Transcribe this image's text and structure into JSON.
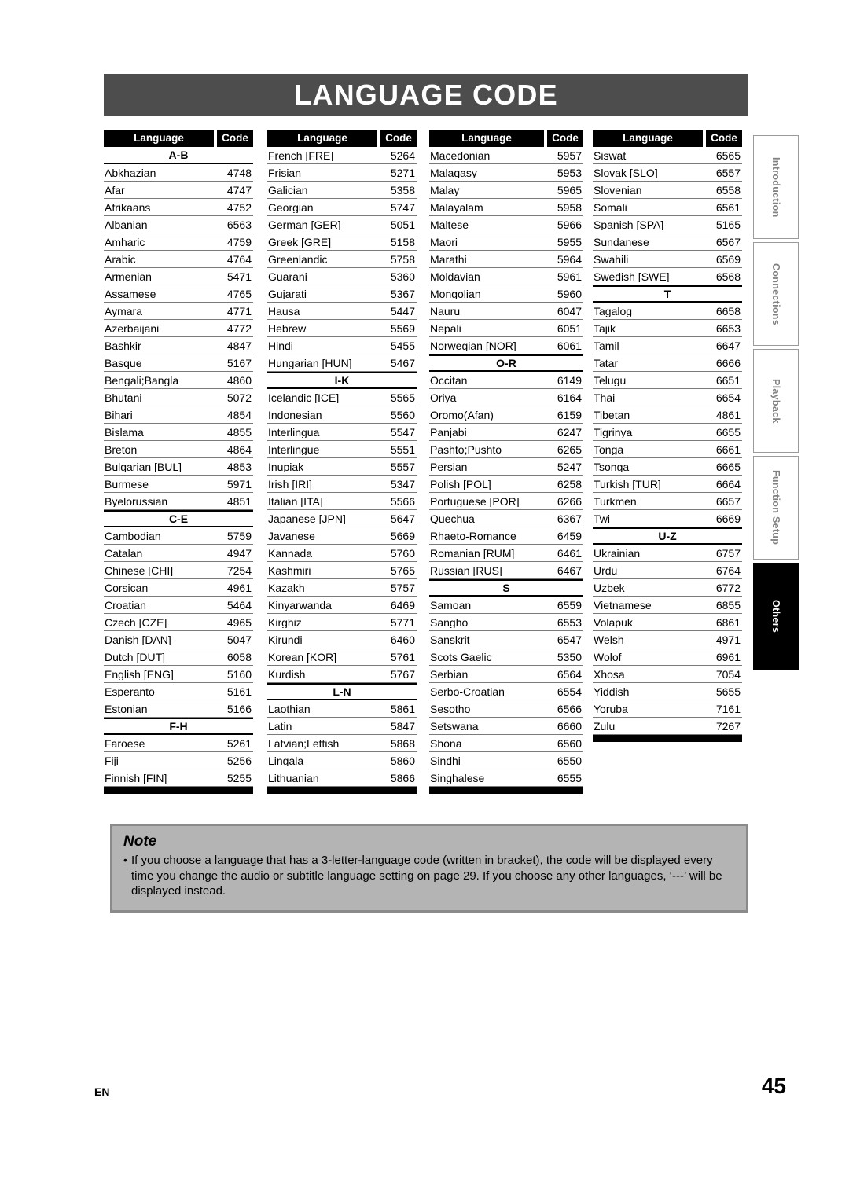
{
  "page": {
    "title": "LANGUAGE CODE",
    "footer_language": "EN",
    "footer_page_number": "45"
  },
  "side_tabs": [
    {
      "label": "Introduction",
      "active": false
    },
    {
      "label": "Connections",
      "active": false
    },
    {
      "label": "Playback",
      "active": false
    },
    {
      "label": "Function Setup",
      "active": false
    },
    {
      "label": "Others",
      "active": true
    }
  ],
  "table_headers": {
    "language": "Language",
    "code": "Code"
  },
  "tables": [
    {
      "rows": [
        {
          "type": "group",
          "label": "A-B"
        },
        {
          "type": "entry",
          "language": "Abkhazian",
          "code": "4748"
        },
        {
          "type": "entry",
          "language": "Afar",
          "code": "4747"
        },
        {
          "type": "entry",
          "language": "Afrikaans",
          "code": "4752"
        },
        {
          "type": "entry",
          "language": "Albanian",
          "code": "6563"
        },
        {
          "type": "entry",
          "language": "Amharic",
          "code": "4759"
        },
        {
          "type": "entry",
          "language": "Arabic",
          "code": "4764"
        },
        {
          "type": "entry",
          "language": "Armenian",
          "code": "5471"
        },
        {
          "type": "entry",
          "language": "Assamese",
          "code": "4765"
        },
        {
          "type": "entry",
          "language": "Aymara",
          "code": "4771"
        },
        {
          "type": "entry",
          "language": "Azerbaijani",
          "code": "4772"
        },
        {
          "type": "entry",
          "language": "Bashkir",
          "code": "4847"
        },
        {
          "type": "entry",
          "language": "Basque",
          "code": "5167"
        },
        {
          "type": "entry",
          "language": "Bengali;Bangla",
          "code": "4860"
        },
        {
          "type": "entry",
          "language": "Bhutani",
          "code": "5072"
        },
        {
          "type": "entry",
          "language": "Bihari",
          "code": "4854"
        },
        {
          "type": "entry",
          "language": "Bislama",
          "code": "4855"
        },
        {
          "type": "entry",
          "language": "Breton",
          "code": "4864"
        },
        {
          "type": "entry",
          "language": "Bulgarian [BUL]",
          "code": "4853"
        },
        {
          "type": "entry",
          "language": "Burmese",
          "code": "5971"
        },
        {
          "type": "entry",
          "language": "Byelorussian",
          "code": "4851"
        },
        {
          "type": "group",
          "label": "C-E"
        },
        {
          "type": "entry",
          "language": "Cambodian",
          "code": "5759"
        },
        {
          "type": "entry",
          "language": "Catalan",
          "code": "4947"
        },
        {
          "type": "entry",
          "language": "Chinese [CHI]",
          "code": "7254"
        },
        {
          "type": "entry",
          "language": "Corsican",
          "code": "4961"
        },
        {
          "type": "entry",
          "language": "Croatian",
          "code": "5464"
        },
        {
          "type": "entry",
          "language": "Czech [CZE]",
          "code": "4965"
        },
        {
          "type": "entry",
          "language": "Danish [DAN]",
          "code": "5047"
        },
        {
          "type": "entry",
          "language": "Dutch [DUT]",
          "code": "6058"
        },
        {
          "type": "entry",
          "language": "English [ENG]",
          "code": "5160"
        },
        {
          "type": "entry",
          "language": "Esperanto",
          "code": "5161"
        },
        {
          "type": "entry",
          "language": "Estonian",
          "code": "5166"
        },
        {
          "type": "group",
          "label": "F-H"
        },
        {
          "type": "entry",
          "language": "Faroese",
          "code": "5261"
        },
        {
          "type": "entry",
          "language": "Fiji",
          "code": "5256"
        },
        {
          "type": "entry",
          "language": "Finnish [FIN]",
          "code": "5255"
        }
      ]
    },
    {
      "rows": [
        {
          "type": "entry",
          "language": "French [FRE]",
          "code": "5264"
        },
        {
          "type": "entry",
          "language": "Frisian",
          "code": "5271"
        },
        {
          "type": "entry",
          "language": "Galician",
          "code": "5358"
        },
        {
          "type": "entry",
          "language": "Georgian",
          "code": "5747"
        },
        {
          "type": "entry",
          "language": "German [GER]",
          "code": "5051"
        },
        {
          "type": "entry",
          "language": "Greek [GRE]",
          "code": "5158"
        },
        {
          "type": "entry",
          "language": "Greenlandic",
          "code": "5758"
        },
        {
          "type": "entry",
          "language": "Guarani",
          "code": "5360"
        },
        {
          "type": "entry",
          "language": "Gujarati",
          "code": "5367"
        },
        {
          "type": "entry",
          "language": "Hausa",
          "code": "5447"
        },
        {
          "type": "entry",
          "language": "Hebrew",
          "code": "5569"
        },
        {
          "type": "entry",
          "language": "Hindi",
          "code": "5455"
        },
        {
          "type": "entry",
          "language": "Hungarian [HUN]",
          "code": "5467"
        },
        {
          "type": "group",
          "label": "I-K"
        },
        {
          "type": "entry",
          "language": "Icelandic [ICE]",
          "code": "5565"
        },
        {
          "type": "entry",
          "language": "Indonesian",
          "code": "5560"
        },
        {
          "type": "entry",
          "language": "Interlingua",
          "code": "5547"
        },
        {
          "type": "entry",
          "language": "Interlingue",
          "code": "5551"
        },
        {
          "type": "entry",
          "language": "Inupiak",
          "code": "5557"
        },
        {
          "type": "entry",
          "language": "Irish [IRI]",
          "code": "5347"
        },
        {
          "type": "entry",
          "language": "Italian [ITA]",
          "code": "5566"
        },
        {
          "type": "entry",
          "language": "Japanese [JPN]",
          "code": "5647"
        },
        {
          "type": "entry",
          "language": "Javanese",
          "code": "5669"
        },
        {
          "type": "entry",
          "language": "Kannada",
          "code": "5760"
        },
        {
          "type": "entry",
          "language": "Kashmiri",
          "code": "5765"
        },
        {
          "type": "entry",
          "language": "Kazakh",
          "code": "5757"
        },
        {
          "type": "entry",
          "language": "Kinyarwanda",
          "code": "6469"
        },
        {
          "type": "entry",
          "language": "Kirghiz",
          "code": "5771"
        },
        {
          "type": "entry",
          "language": "Kirundi",
          "code": "6460"
        },
        {
          "type": "entry",
          "language": "Korean [KOR]",
          "code": "5761"
        },
        {
          "type": "entry",
          "language": "Kurdish",
          "code": "5767"
        },
        {
          "type": "group",
          "label": "L-N"
        },
        {
          "type": "entry",
          "language": "Laothian",
          "code": "5861"
        },
        {
          "type": "entry",
          "language": "Latin",
          "code": "5847"
        },
        {
          "type": "entry",
          "language": "Latvian;Lettish",
          "code": "5868"
        },
        {
          "type": "entry",
          "language": "Lingala",
          "code": "5860"
        },
        {
          "type": "entry",
          "language": "Lithuanian",
          "code": "5866"
        }
      ]
    },
    {
      "rows": [
        {
          "type": "entry",
          "language": "Macedonian",
          "code": "5957"
        },
        {
          "type": "entry",
          "language": "Malagasy",
          "code": "5953"
        },
        {
          "type": "entry",
          "language": "Malay",
          "code": "5965"
        },
        {
          "type": "entry",
          "language": "Malayalam",
          "code": "5958"
        },
        {
          "type": "entry",
          "language": "Maltese",
          "code": "5966"
        },
        {
          "type": "entry",
          "language": "Maori",
          "code": "5955"
        },
        {
          "type": "entry",
          "language": "Marathi",
          "code": "5964"
        },
        {
          "type": "entry",
          "language": "Moldavian",
          "code": "5961"
        },
        {
          "type": "entry",
          "language": "Mongolian",
          "code": "5960"
        },
        {
          "type": "entry",
          "language": "Nauru",
          "code": "6047"
        },
        {
          "type": "entry",
          "language": "Nepali",
          "code": "6051"
        },
        {
          "type": "entry",
          "language": "Norwegian [NOR]",
          "code": "6061"
        },
        {
          "type": "group",
          "label": "O-R"
        },
        {
          "type": "entry",
          "language": "Occitan",
          "code": "6149"
        },
        {
          "type": "entry",
          "language": "Oriya",
          "code": "6164"
        },
        {
          "type": "entry",
          "language": "Oromo(Afan)",
          "code": "6159"
        },
        {
          "type": "entry",
          "language": "Panjabi",
          "code": "6247"
        },
        {
          "type": "entry",
          "language": "Pashto;Pushto",
          "code": "6265"
        },
        {
          "type": "entry",
          "language": "Persian",
          "code": "5247"
        },
        {
          "type": "entry",
          "language": "Polish [POL]",
          "code": "6258"
        },
        {
          "type": "entry",
          "language": "Portuguese [POR]",
          "code": "6266"
        },
        {
          "type": "entry",
          "language": "Quechua",
          "code": "6367"
        },
        {
          "type": "entry",
          "language": "Rhaeto-Romance",
          "code": "6459"
        },
        {
          "type": "entry",
          "language": "Romanian [RUM]",
          "code": "6461"
        },
        {
          "type": "entry",
          "language": "Russian [RUS]",
          "code": "6467"
        },
        {
          "type": "group",
          "label": "S"
        },
        {
          "type": "entry",
          "language": "Samoan",
          "code": "6559"
        },
        {
          "type": "entry",
          "language": "Sangho",
          "code": "6553"
        },
        {
          "type": "entry",
          "language": "Sanskrit",
          "code": "6547"
        },
        {
          "type": "entry",
          "language": "Scots Gaelic",
          "code": "5350"
        },
        {
          "type": "entry",
          "language": "Serbian",
          "code": "6564"
        },
        {
          "type": "entry",
          "language": "Serbo-Croatian",
          "code": "6554"
        },
        {
          "type": "entry",
          "language": "Sesotho",
          "code": "6566"
        },
        {
          "type": "entry",
          "language": "Setswana",
          "code": "6660"
        },
        {
          "type": "entry",
          "language": "Shona",
          "code": "6560"
        },
        {
          "type": "entry",
          "language": "Sindhi",
          "code": "6550"
        },
        {
          "type": "entry",
          "language": "Singhalese",
          "code": "6555"
        }
      ]
    },
    {
      "rows": [
        {
          "type": "entry",
          "language": "Siswat",
          "code": "6565"
        },
        {
          "type": "entry",
          "language": "Slovak [SLO]",
          "code": "6557"
        },
        {
          "type": "entry",
          "language": "Slovenian",
          "code": "6558"
        },
        {
          "type": "entry",
          "language": "Somali",
          "code": "6561"
        },
        {
          "type": "entry",
          "language": "Spanish [SPA]",
          "code": "5165"
        },
        {
          "type": "entry",
          "language": "Sundanese",
          "code": "6567"
        },
        {
          "type": "entry",
          "language": "Swahili",
          "code": "6569"
        },
        {
          "type": "entry",
          "language": "Swedish [SWE]",
          "code": "6568"
        },
        {
          "type": "group",
          "label": "T"
        },
        {
          "type": "entry",
          "language": "Tagalog",
          "code": "6658"
        },
        {
          "type": "entry",
          "language": "Tajik",
          "code": "6653"
        },
        {
          "type": "entry",
          "language": "Tamil",
          "code": "6647"
        },
        {
          "type": "entry",
          "language": "Tatar",
          "code": "6666"
        },
        {
          "type": "entry",
          "language": "Telugu",
          "code": "6651"
        },
        {
          "type": "entry",
          "language": "Thai",
          "code": "6654"
        },
        {
          "type": "entry",
          "language": "Tibetan",
          "code": "4861"
        },
        {
          "type": "entry",
          "language": "Tigrinya",
          "code": "6655"
        },
        {
          "type": "entry",
          "language": "Tonga",
          "code": "6661"
        },
        {
          "type": "entry",
          "language": "Tsonga",
          "code": "6665"
        },
        {
          "type": "entry",
          "language": "Turkish [TUR]",
          "code": "6664"
        },
        {
          "type": "entry",
          "language": "Turkmen",
          "code": "6657"
        },
        {
          "type": "entry",
          "language": "Twi",
          "code": "6669"
        },
        {
          "type": "group",
          "label": "U-Z"
        },
        {
          "type": "entry",
          "language": "Ukrainian",
          "code": "6757"
        },
        {
          "type": "entry",
          "language": "Urdu",
          "code": "6764"
        },
        {
          "type": "entry",
          "language": "Uzbek",
          "code": "6772"
        },
        {
          "type": "entry",
          "language": "Vietnamese",
          "code": "6855"
        },
        {
          "type": "entry",
          "language": "Volapuk",
          "code": "6861"
        },
        {
          "type": "entry",
          "language": "Welsh",
          "code": "4971"
        },
        {
          "type": "entry",
          "language": "Wolof",
          "code": "6961"
        },
        {
          "type": "entry",
          "language": "Xhosa",
          "code": "7054"
        },
        {
          "type": "entry",
          "language": "Yiddish",
          "code": "5655"
        },
        {
          "type": "entry",
          "language": "Yoruba",
          "code": "7161"
        },
        {
          "type": "entry",
          "language": "Zulu",
          "code": "7267"
        }
      ]
    }
  ],
  "note": {
    "title": "Note",
    "bullet": "•",
    "text": "If you choose a language that has a 3-letter-language code (written in bracket), the code will be displayed every time you change the audio or subtitle language setting on page 29. If you choose any other languages, ‘---’ will be displayed instead."
  },
  "colors": {
    "title_banner": "#4d4d4d",
    "header_bar": "#000000",
    "note_background": "#b4b4b4",
    "note_border": "#8a8a8a",
    "active_tab": "#000000",
    "inactive_tab_text": "#808080"
  }
}
